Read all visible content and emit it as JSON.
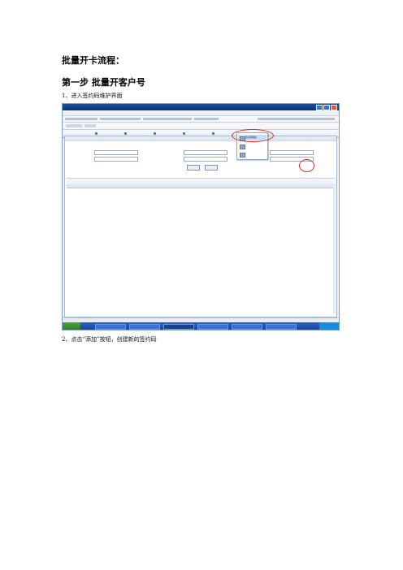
{
  "document": {
    "title": "批量开卡流程：",
    "step1_heading": "第一步 批量开客户号",
    "instruction_1": "1、进入签约码维护界面",
    "instruction_2": "2、点击“添加”按钮，创建新的签约码"
  },
  "screenshot": {
    "panel_title": "签约码维护",
    "dropdown_items": [
      "签约码维护",
      "",
      ""
    ],
    "highlight_color": "#e2231a"
  }
}
